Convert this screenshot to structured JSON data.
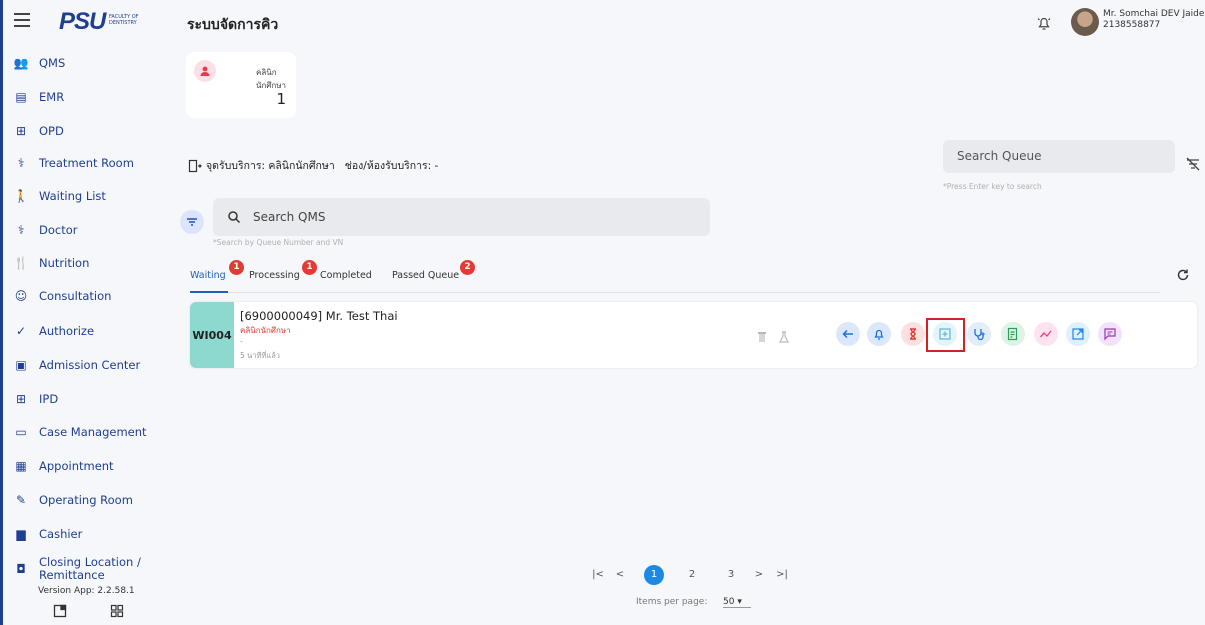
{
  "header": {
    "logo_text": "PSU",
    "logo_sub": "FACULTY OF DENTISTRY",
    "app_title": "ระบบจัดการคิว",
    "user_name": "Mr. Somchai DEV Jaide",
    "user_id": "2138558877"
  },
  "sidebar": {
    "items": [
      {
        "label": "QMS",
        "icon": "people-icon"
      },
      {
        "label": "EMR",
        "icon": "emr-icon"
      },
      {
        "label": "OPD",
        "icon": "opd-icon"
      },
      {
        "label": "Treatment Room",
        "icon": "treatment-icon"
      },
      {
        "label": "Waiting List",
        "icon": "waiting-icon"
      },
      {
        "label": "Doctor",
        "icon": "stethoscope-icon"
      },
      {
        "label": "Nutrition",
        "icon": "fork-knife-icon"
      },
      {
        "label": "Consultation",
        "icon": "consultation-icon"
      },
      {
        "label": "Authorize",
        "icon": "shield-check-icon"
      },
      {
        "label": "Admission Center",
        "icon": "admission-icon"
      },
      {
        "label": "IPD",
        "icon": "ipd-icon"
      },
      {
        "label": "Case Management",
        "icon": "case-icon"
      },
      {
        "label": "Appointment",
        "icon": "calendar-icon"
      },
      {
        "label": "Operating Room",
        "icon": "scalpel-icon"
      },
      {
        "label": "Cashier",
        "icon": "cashier-icon"
      },
      {
        "label": "Closing Location / Remittance",
        "icon": "money-icon"
      }
    ],
    "version": "Version App: 2.2.58.1"
  },
  "stat": {
    "label": "คลินิกนักศึกษา",
    "value": "1"
  },
  "location": {
    "service_point": "จุดรับบริการ: คลินิกนักศึกษา",
    "room": "ช่อง/ห้องรับบริการ: -"
  },
  "search_queue": {
    "placeholder": "Search Queue",
    "hint": "*Press Enter key to search"
  },
  "search_qms": {
    "placeholder": "Search QMS",
    "hint": "*Search by Queue Number and VN"
  },
  "tabs": [
    {
      "label": "Waiting",
      "badge": "1"
    },
    {
      "label": "Processing",
      "badge": "1"
    },
    {
      "label": "Completed",
      "badge": ""
    },
    {
      "label": "Passed Queue",
      "badge": "2"
    }
  ],
  "queue": {
    "number": "WI004",
    "patient": "[6900000049] Mr. Test Thai",
    "clinic": "คลินิกนักศึกษา",
    "detail": "-",
    "elapsed": "5 นาทีที่แล้ว"
  },
  "actions": [
    {
      "name": "back-icon",
      "bg": "#dbe8fb",
      "fg": "#1e6fd9"
    },
    {
      "name": "bell-icon",
      "bg": "#dbe8fb",
      "fg": "#1e6fd9"
    },
    {
      "name": "hourglass-icon",
      "bg": "#fde0e0",
      "fg": "#e53935"
    },
    {
      "name": "add-box-icon",
      "bg": "#e3f4fb",
      "fg": "#5fb3d9"
    },
    {
      "name": "stethoscope-icon",
      "bg": "#e2ecfb",
      "fg": "#1e6fd9"
    },
    {
      "name": "document-icon",
      "bg": "#dcf3e6",
      "fg": "#2e9e5a"
    },
    {
      "name": "trend-icon",
      "bg": "#fde3ef",
      "fg": "#e64980"
    },
    {
      "name": "open-external-icon",
      "bg": "#dff0fb",
      "fg": "#1e88e5"
    },
    {
      "name": "message-icon",
      "bg": "#f2e2fb",
      "fg": "#9c36b5"
    }
  ],
  "pagination": {
    "pages": [
      "1",
      "2",
      "3"
    ],
    "items_per_page_label": "Items per page:",
    "items_per_page": "50 ▾"
  }
}
